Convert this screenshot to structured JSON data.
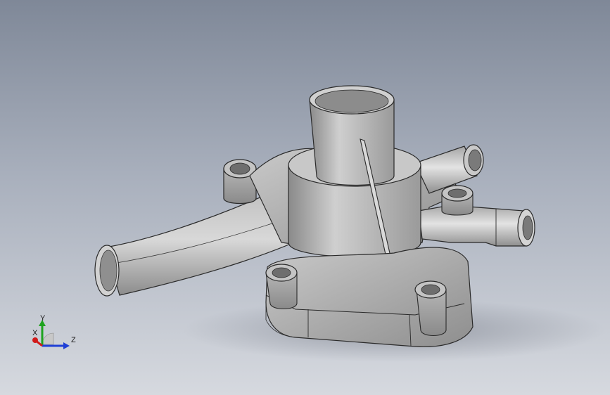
{
  "viewport": {
    "background_top": "#7f8898",
    "background_bottom": "#d6d9df",
    "part_color": "#b8b8b8"
  },
  "triad": {
    "x_label": "X",
    "y_label": "Y",
    "z_label": "Z",
    "x_color": "#d11a1a",
    "y_color": "#1fa31f",
    "z_color": "#1f3fd6"
  }
}
